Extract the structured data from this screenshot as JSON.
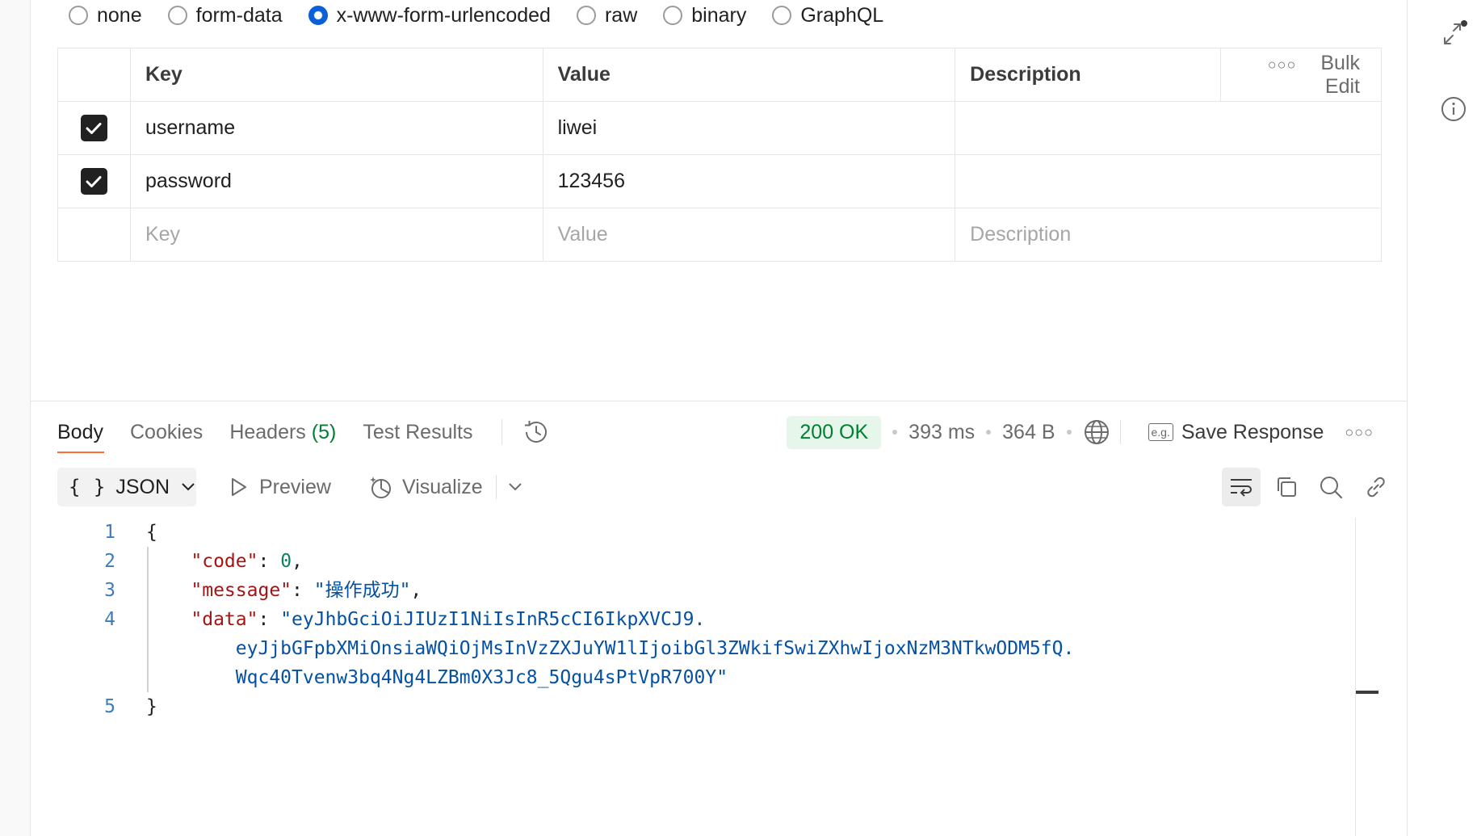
{
  "body_types": {
    "options": [
      "none",
      "form-data",
      "x-www-form-urlencoded",
      "raw",
      "binary",
      "GraphQL"
    ],
    "selected": "x-www-form-urlencoded"
  },
  "params": {
    "headers": {
      "key": "Key",
      "value": "Value",
      "description": "Description",
      "bulk_edit": "Bulk Edit"
    },
    "rows": [
      {
        "checked": true,
        "key": "username",
        "value": "liwei",
        "description": ""
      },
      {
        "checked": true,
        "key": "password",
        "value": "123456",
        "description": ""
      }
    ],
    "placeholders": {
      "key": "Key",
      "value": "Value",
      "description": "Description"
    }
  },
  "response": {
    "tabs": {
      "body": "Body",
      "cookies": "Cookies",
      "headers_label": "Headers",
      "headers_count": "(5)",
      "test_results": "Test Results"
    },
    "status": "200 OK",
    "time": "393 ms",
    "size": "364 B",
    "save_response": "Save Response",
    "eg_label": "e.g.",
    "format": "JSON",
    "preview": "Preview",
    "visualize": "Visualize",
    "code": {
      "line_numbers": [
        "1",
        "2",
        "3",
        "4",
        "",
        "",
        "5"
      ],
      "open_brace": "{",
      "close_brace": "}",
      "code_key": "\"code\"",
      "code_value": "0",
      "message_key": "\"message\"",
      "message_value": "\"操作成功\"",
      "data_key": "\"data\"",
      "data_value_1": "\"eyJhbGciOiJIUzI1NiIsInR5cCI6IkpXVCJ9.",
      "data_value_2": "eyJjbGFpbXMiOnsiaWQiOjMsInVzZXJuYW1lIjoibGl3ZWkifSwiZXhwIjoxNzM3NTkwODM5fQ.",
      "data_value_3": "Wqc40Tvenw3bq4Ng4LZBm0X3Jc8_5Qgu4sPtVpR700Y\""
    }
  },
  "colors": {
    "accent": "#ff6c37",
    "status_green": "#007f31",
    "radio_blue": "#0b5fd7"
  }
}
